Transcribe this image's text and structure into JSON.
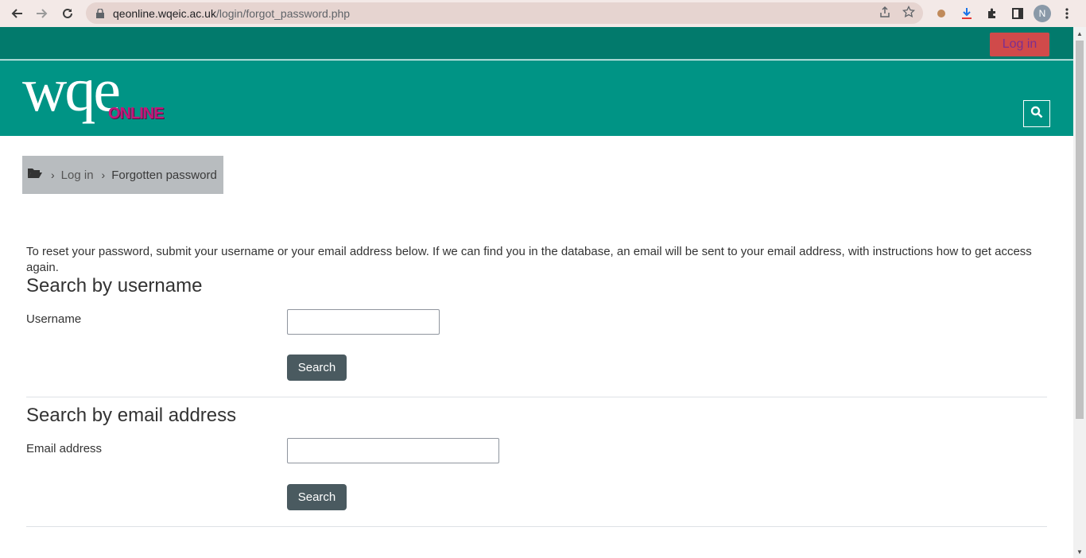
{
  "browser": {
    "url_host": "qeonline.wqeic.ac.uk",
    "url_path": "/login/forgot_password.php",
    "profile_initial": "N"
  },
  "header": {
    "login_label": "Log in",
    "logo_main": "wqe",
    "logo_sub": "ONLINE"
  },
  "breadcrumb": {
    "items": [
      "Log in",
      "Forgotten password"
    ]
  },
  "main": {
    "intro": "To reset your password, submit your username or your email address below. If we can find you in the database, an email will be sent to your email address, with instructions how to get access again.",
    "username_section": {
      "title": "Search by username",
      "label": "Username",
      "value": "",
      "button": "Search"
    },
    "email_section": {
      "title": "Search by email address",
      "label": "Email address",
      "value": "",
      "button": "Search"
    }
  },
  "colors": {
    "topbar": "#027a6c",
    "brandbar": "#009485",
    "login_button": "#d04a4a",
    "search_button": "#4a5a60"
  }
}
